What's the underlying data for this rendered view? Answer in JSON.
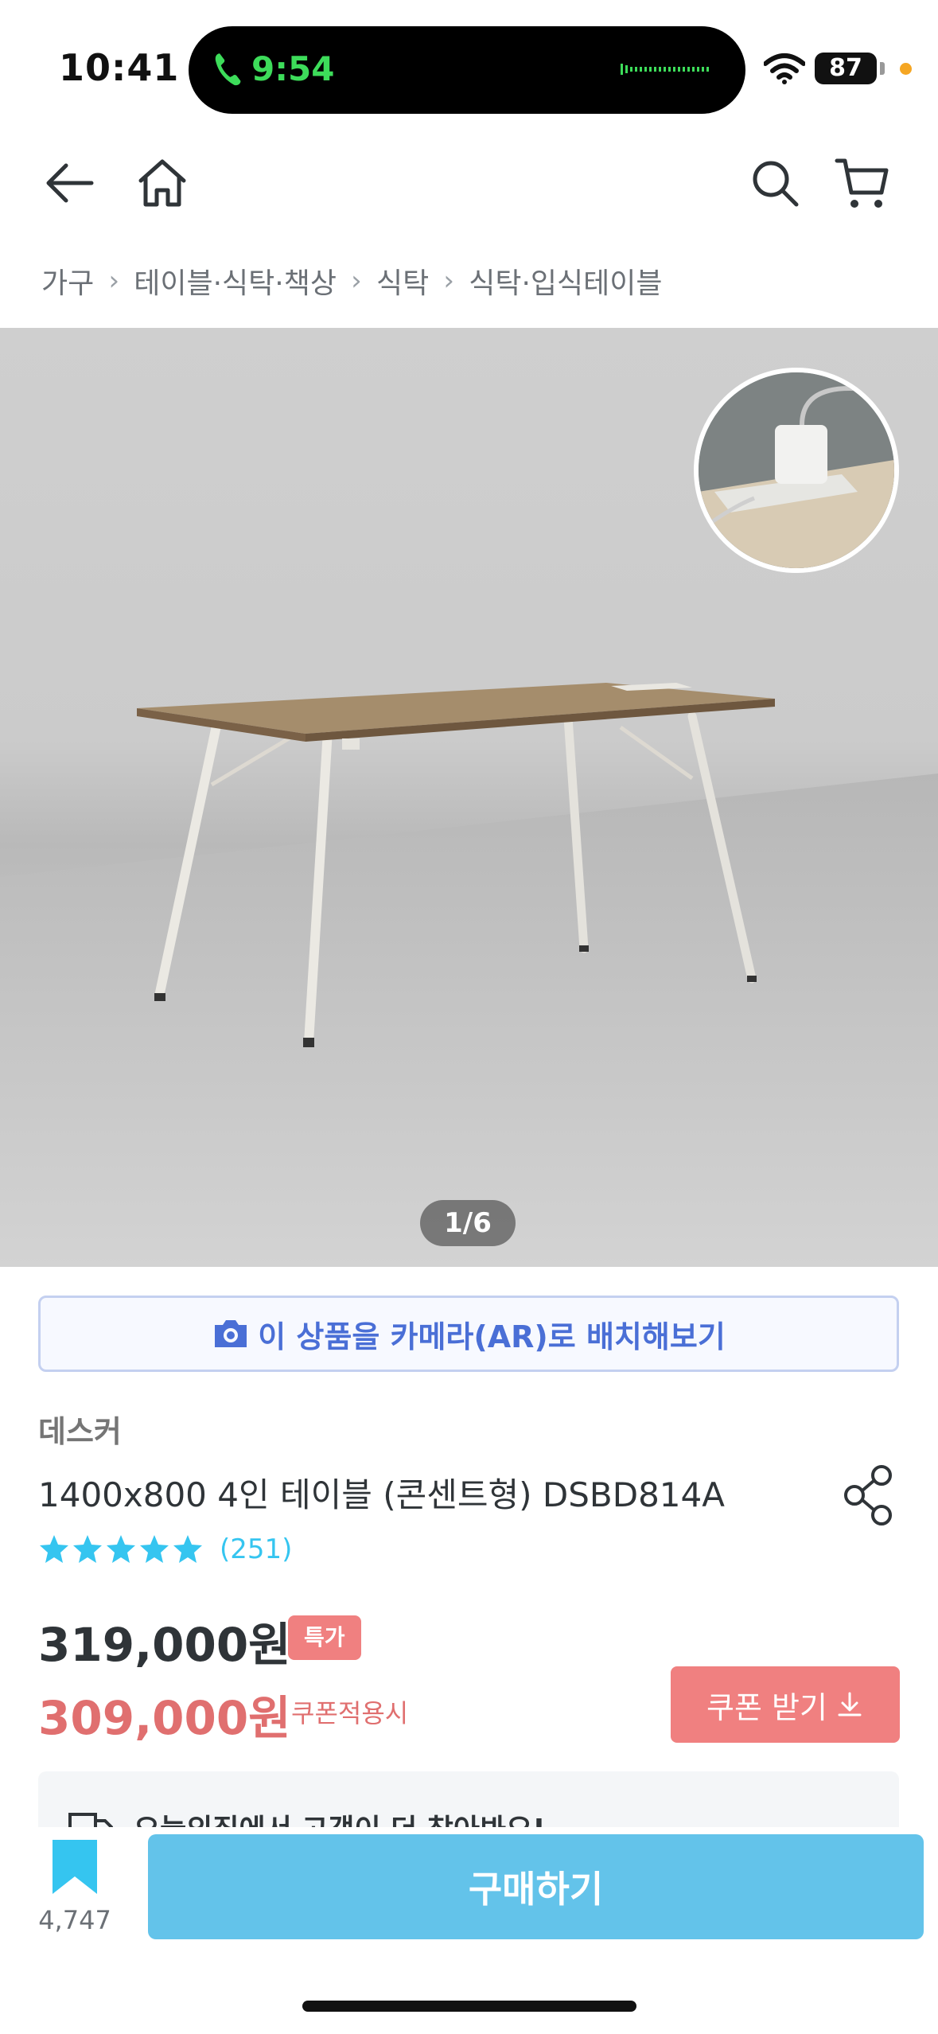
{
  "status_bar": {
    "clock": "10:41",
    "call_time": "9:54",
    "battery": "87",
    "icons": [
      "phone-icon",
      "wifi-icon",
      "battery-icon"
    ]
  },
  "nav": {
    "icons": [
      "back-arrow-icon",
      "home-icon",
      "search-icon",
      "cart-icon"
    ]
  },
  "breadcrumb": [
    "가구",
    "테이블·식탁·책상",
    "식탁",
    "식탁·입식테이블"
  ],
  "gallery": {
    "counter": "1/6"
  },
  "ar_button": {
    "label": "이 상품을 카메라(AR)로 배치해보기",
    "icon": "camera-icon"
  },
  "product": {
    "brand": "데스커",
    "title": "1400x800 4인 테이블 (콘센트형) DSBD814A",
    "rating": 5,
    "review_count": "(251)",
    "price_original": "319,000원",
    "price_badge": "특가",
    "price_coupon": "309,000원",
    "coupon_note": "쿠폰적용시",
    "coupon_button": "쿠폰 받기"
  },
  "info_strip": {
    "text": "오늘의집에서 고객이 더 찾아봐요!"
  },
  "bottom_bar": {
    "scrap_count": "4,747",
    "buy_button": "구매하기"
  },
  "colors": {
    "accent": "#63c3ea",
    "sale": "#f08080",
    "star": "#35c5f0",
    "ar": "#4a6fd6"
  }
}
